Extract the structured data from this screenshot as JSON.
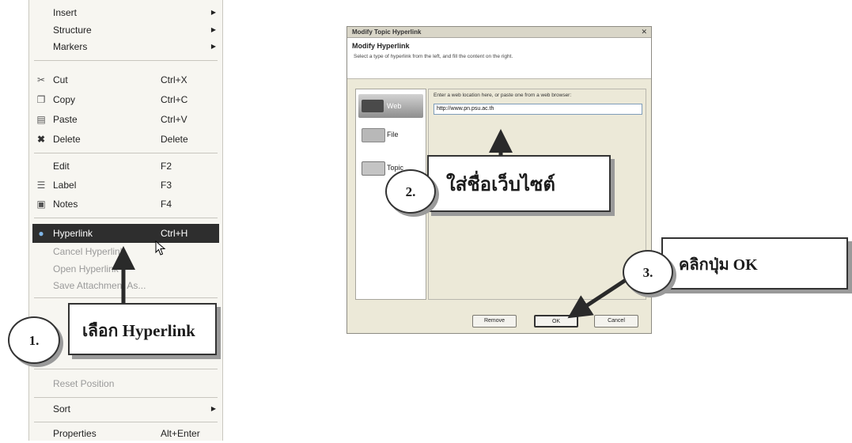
{
  "menu": {
    "insert": "Insert",
    "structure": "Structure",
    "markers": "Markers",
    "cut": "Cut",
    "cut_key": "Ctrl+X",
    "copy": "Copy",
    "copy_key": "Ctrl+C",
    "paste": "Paste",
    "paste_key": "Ctrl+V",
    "delete": "Delete",
    "delete_key": "Delete",
    "edit": "Edit",
    "edit_key": "F2",
    "label": "Label",
    "label_key": "F3",
    "notes": "Notes",
    "notes_key": "F4",
    "hyperlink": "Hyperlink",
    "hyperlink_key": "Ctrl+H",
    "cancel_hyperlink": "Cancel Hyperlink",
    "open_hyperlink": "Open Hyperlink",
    "save_attachment": "Save Attachment As...",
    "reset_position": "Reset Position",
    "sort": "Sort",
    "properties": "Properties",
    "properties_key": "Alt+Enter"
  },
  "dialog": {
    "title": "Modify Topic Hyperlink",
    "heading": "Modify Hyperlink",
    "subtitle": "Select a type of hyperlink from the left, and fill the content on the right.",
    "options": [
      "Web",
      "File",
      "Topic"
    ],
    "prompt": "Enter a web location here, or paste one from a web browser:",
    "url_value": "http://www.pn.psu.ac.th",
    "remove": "Remove",
    "ok": "OK",
    "cancel": "Cancel"
  },
  "callouts": {
    "step1_num": "1.",
    "step1_text": "เลือก Hyperlink",
    "step2_num": "2.",
    "step2_text": "ใส่ชื่อเว็บไซต์",
    "step3_num": "3.",
    "step3_text": "คลิกปุ่ม OK"
  }
}
